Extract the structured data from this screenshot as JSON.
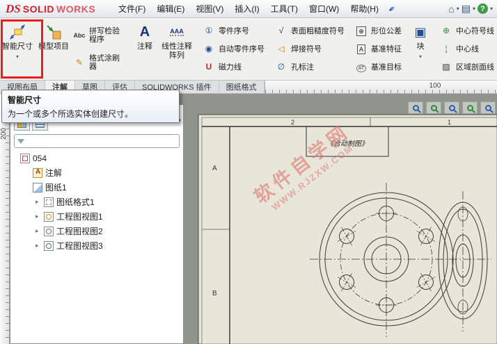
{
  "app": {
    "logo_ds": "DS",
    "logo_solid": "SOLID",
    "logo_works": "WORKS"
  },
  "menubar": {
    "items": [
      "文件(F)",
      "编辑(E)",
      "视图(V)",
      "插入(I)",
      "工具(T)",
      "窗口(W)",
      "帮助(H)"
    ]
  },
  "icons": {
    "pin": "✒",
    "home": "⌂",
    "chevron": "▾",
    "gear": "▤",
    "help": "?",
    "spell_text": "Abc",
    "check": "✓",
    "painter": "✎",
    "note_text": "A",
    "linear_text": "AAA",
    "balloon": "①",
    "auto_balloon": "◉",
    "magnet": "U",
    "surface": "√",
    "weld": "◁",
    "hole": "∅",
    "geo": "⊕",
    "datum": "A",
    "datum_target": "AT",
    "block": "▣",
    "center_mark": "⊕",
    "centerline": "¦",
    "hatch": "▨",
    "panel_collapse": "›",
    "tree_expand": "▸",
    "tree_collapse": "▾"
  },
  "ribbon": {
    "smart_dimension": "智能尺寸",
    "model_items": "模型项目",
    "spell_checker": "拼写检验程序",
    "format_painter": "格式涂刷器",
    "note": "注释",
    "linear_note_pattern": "线性注释阵列",
    "balloon": "零件序号",
    "auto_balloon": "自动零件序号",
    "magnetic_line": "磁力线",
    "surface_finish": "表面粗糙度符号",
    "weld_symbol": "焊接符号",
    "hole_callout": "孔标注",
    "geo_tolerance": "形位公差",
    "datum_feature": "基准特征",
    "datum_target": "基准目标",
    "blocks": "块",
    "center_mark": "中心符号线",
    "centerline": "中心线",
    "area_hatch": "区域剖面线"
  },
  "tabs": {
    "items": [
      "视图布局",
      "注解",
      "草图",
      "评估",
      "SOLIDWORKS 插件",
      "图纸格式"
    ]
  },
  "tooltip": {
    "title": "智能尺寸",
    "desc": "为一个或多个所选实体创建尺寸。"
  },
  "tree": {
    "root": "054",
    "annotations": "注解",
    "sheet": "图纸1",
    "sheet_format": "图纸格式1",
    "view1": "工程图视图1",
    "view2": "工程图视图2",
    "view3": "工程图视图3"
  },
  "rulers": {
    "h_label": "100",
    "v_label": "200"
  },
  "drawing": {
    "zone_col_1": "2",
    "zone_col_2": "1",
    "zone_row_1": "A",
    "zone_row_2": "B",
    "title_note": "《合动制图》",
    "watermark_1": "软件自学网",
    "watermark_2": "WWW.RJZXW.COM"
  }
}
